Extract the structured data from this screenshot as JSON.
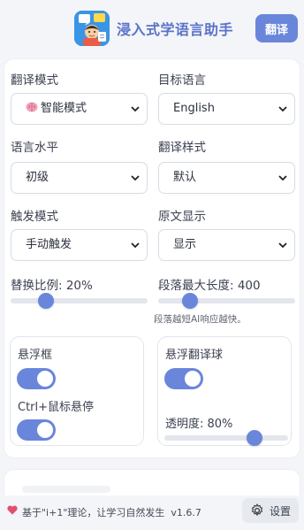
{
  "header": {
    "logo_icon": "app-logo-icon",
    "title": "浸入式学语言助手",
    "translate_button": "翻译"
  },
  "settings": {
    "translation_mode": {
      "label": "翻译模式",
      "icon": "brain-emoji",
      "value": "智能模式"
    },
    "target_language": {
      "label": "目标语言",
      "value": "English"
    },
    "language_level": {
      "label": "语言水平",
      "value": "初级"
    },
    "translation_style": {
      "label": "翻译样式",
      "value": "默认"
    },
    "trigger_mode": {
      "label": "触发模式",
      "value": "手动触发"
    },
    "original_display": {
      "label": "原文显示",
      "value": "显示"
    },
    "replace_ratio": {
      "label": "替换比例: 20%",
      "value": 0.2
    },
    "max_paragraph_length": {
      "label": "段落最大长度: 400",
      "value": 400,
      "hint": "段落越短AI响应越快。"
    }
  },
  "floating_box": {
    "title": "悬浮框",
    "enabled": true,
    "ctrl_hover_label": "Ctrl+鼠标悬停",
    "ctrl_hover_enabled": true
  },
  "floating_ball": {
    "title": "悬浮翻译球",
    "enabled": true,
    "opacity_label": "透明度: 80%",
    "opacity": 0.8
  },
  "footer": {
    "heart_icon": "heart-icon",
    "tagline": "基于\"i+1\"理论，让学习自然发生",
    "version": "v1.6.7",
    "settings_label": "设置",
    "settings_icon": "gear-icon"
  },
  "colors": {
    "accent": "#6a86db",
    "title": "#5b73c8",
    "track": "#e3e6ec"
  }
}
